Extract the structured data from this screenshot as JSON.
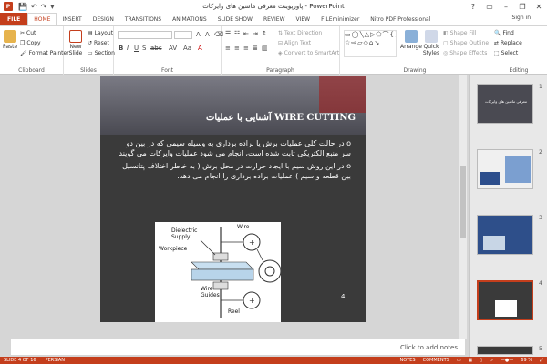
{
  "window": {
    "title": "پاورپوینت معرفی ماشین های وایرکات - PowerPoint",
    "app_icon": "P",
    "signin": "Sign in"
  },
  "tabs": [
    "FILE",
    "HOME",
    "INSERT",
    "DESIGN",
    "TRANSITIONS",
    "ANIMATIONS",
    "SLIDE SHOW",
    "REVIEW",
    "VIEW",
    "FILEminimizer",
    "Nitro PDF Professional"
  ],
  "ribbon": {
    "clipboard": {
      "paste": "Paste",
      "cut": "Cut",
      "copy": "Copy",
      "format_painter": "Format Painter",
      "label": "Clipboard"
    },
    "slides": {
      "new_slide": "New Slide",
      "layout": "Layout",
      "reset": "Reset",
      "section": "Section",
      "label": "Slides"
    },
    "font": {
      "label": "Font"
    },
    "paragraph": {
      "text_direction": "Text Direction",
      "align_text": "Align Text",
      "convert_smartart": "Convert to SmartArt",
      "label": "Paragraph"
    },
    "drawing": {
      "arrange": "Arrange",
      "quick_styles": "Quick Styles",
      "shape_fill": "Shape Fill",
      "shape_outline": "Shape Outline",
      "shape_effects": "Shape Effects",
      "label": "Drawing"
    },
    "editing": {
      "find": "Find",
      "replace": "Replace",
      "select": "Select",
      "label": "Editing"
    }
  },
  "slide": {
    "title": "آشنایی با عملیات  WIRE CUTTING",
    "bullets": [
      "o در حالت  کلی عملیات برش یا براده برداری به وسیله سیمی  که در بین دو سر منبع الکتریکی ثابت شده است، انجام می شود عملیات وایرکات می گویند",
      "o در این روش سیم با ایجاد حرارت در محل برش ( به خاطر اختلاف پتانسیل بین قطعه و سیم ) عملیات براده برداری را انجام می دهد."
    ],
    "diagram_labels": {
      "wire": "Wire",
      "dielectric": "Dielectric\nSupply",
      "workpiece": "Workpiece",
      "wire_guides": "Wire\nGuides",
      "reel": "Reel"
    },
    "number": "4"
  },
  "notes": {
    "placeholder": "Click to add notes"
  },
  "thumbnails": [
    {
      "num": "1",
      "caption": "معرفی ماشین های وایرکات"
    },
    {
      "num": "2",
      "caption": ""
    },
    {
      "num": "3",
      "caption": ""
    },
    {
      "num": "4",
      "caption": ""
    },
    {
      "num": "5",
      "caption": ""
    }
  ],
  "status": {
    "slide_of": "SLIDE 4 OF 16",
    "language": "PERSIAN",
    "notes": "NOTES",
    "comments": "COMMENTS",
    "zoom": "69 %"
  },
  "colors": {
    "accent": "#c43e1c",
    "slide_bg": "#3a3a3a"
  }
}
